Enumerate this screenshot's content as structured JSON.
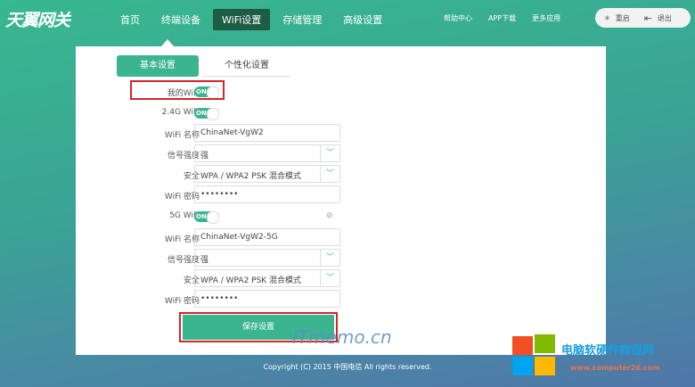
{
  "header": {
    "logo": "天翼网关",
    "nav": [
      "首页",
      "终端设备",
      "WiFi设置",
      "存储管理",
      "高级设置"
    ],
    "active_nav": "WiFi设置",
    "links": [
      "帮助中心",
      "APP下载",
      "更多应用"
    ],
    "restart": "重启",
    "logout": "退出"
  },
  "tabs": [
    "基本设置",
    "个性化设置"
  ],
  "form": {
    "my_wifi": {
      "label": "我的WiFi",
      "toggle": "ON"
    },
    "wifi24": {
      "label": "2.4G WiFi",
      "toggle": "ON",
      "name_label": "WiFi 名称",
      "name": "ChinaNet-VgW2",
      "signal_label": "信号强度",
      "signal": "强",
      "security_label": "安全",
      "security": "WPA / WPA2 PSK 混合模式",
      "password_label": "WiFi 密码",
      "password": "••••••••"
    },
    "wifi5": {
      "label": "5G WiFi",
      "toggle": "ON",
      "name_label": "WiFi 名称",
      "name": "ChinaNet-VgW2-5G",
      "signal_label": "信号强度",
      "signal": "强",
      "security_label": "安全",
      "security": "WPA / WPA2 PSK 混合模式",
      "password_label": "WiFi 密码",
      "password": "••••••••"
    },
    "save": "保存设置"
  },
  "footer": "Copyright (C) 2015 中国电信 All rights reserved.",
  "watermarks": {
    "itmemo": "ITmemo.cn",
    "site_cn": "电脑软硬件教程网",
    "site_url": "www.computer26.com"
  },
  "colors": {
    "accent": "#3ab58f",
    "highlight": "#d6252a"
  }
}
